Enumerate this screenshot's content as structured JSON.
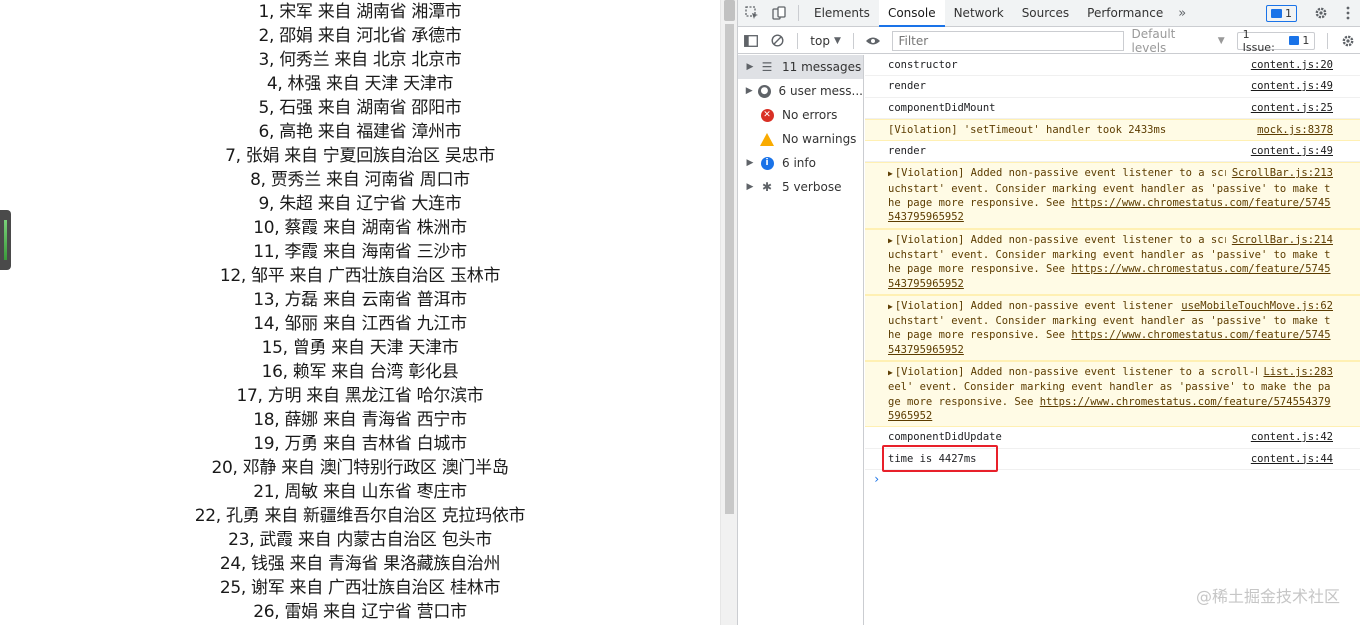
{
  "page": {
    "items": [
      "1, 宋军 来自 湖南省 湘潭市",
      "2, 邵娟 来自 河北省 承德市",
      "3, 何秀兰 来自 北京 北京市",
      "4, 林强 来自 天津 天津市",
      "5, 石强 来自 湖南省 邵阳市",
      "6, 高艳 来自 福建省 漳州市",
      "7, 张娟 来自 宁夏回族自治区 吴忠市",
      "8, 贾秀兰 来自 河南省 周口市",
      "9, 朱超 来自 辽宁省 大连市",
      "10, 蔡霞 来自 湖南省 株洲市",
      "11, 李霞 来自 海南省 三沙市",
      "12, 邹平 来自 广西壮族自治区 玉林市",
      "13, 方磊 来自 云南省 普洱市",
      "14, 邹丽 来自 江西省 九江市",
      "15, 曾勇 来自 天津 天津市",
      "16, 赖军 来自 台湾 彰化县",
      "17, 方明 来自 黑龙江省 哈尔滨市",
      "18, 薛娜 来自 青海省 西宁市",
      "19, 万勇 来自 吉林省 白城市",
      "20, 邓静 来自 澳门特别行政区 澳门半岛",
      "21, 周敏 来自 山东省 枣庄市",
      "22, 孔勇 来自 新疆维吾尔自治区 克拉玛依市",
      "23, 武霞 来自 内蒙古自治区 包头市",
      "24, 钱强 来自 青海省 果洛藏族自治州",
      "25, 谢军 来自 广西壮族自治区 桂林市",
      "26, 雷娟 来自 辽宁省 营口市"
    ]
  },
  "devtools": {
    "tabs": [
      "Elements",
      "Console",
      "Network",
      "Sources",
      "Performance"
    ],
    "more_tabs": "»",
    "messages_badge": "1",
    "toolbar": {
      "context": "top",
      "filter_placeholder": "Filter",
      "levels": "Default levels",
      "issues_label": "1 Issue:",
      "issues_count": "1"
    },
    "sidebar": [
      {
        "label": "11 messages",
        "icon": "list-icon"
      },
      {
        "label": "6 user mess...",
        "icon": "user-icon"
      },
      {
        "label": "No errors",
        "icon": "error-icon"
      },
      {
        "label": "No warnings",
        "icon": "warning-icon"
      },
      {
        "label": "6 info",
        "icon": "info-icon"
      },
      {
        "label": "5 verbose",
        "icon": "bug-icon"
      }
    ],
    "console": [
      {
        "type": "log",
        "text": "constructor",
        "source": "content.js:20"
      },
      {
        "type": "log",
        "text": "render",
        "source": "content.js:49"
      },
      {
        "type": "log",
        "text": "componentDidMount",
        "source": "content.js:25"
      },
      {
        "type": "warn",
        "text": "[Violation] 'setTimeout' handler took 2433ms",
        "source": "mock.js:8378"
      },
      {
        "type": "log",
        "text": "render",
        "source": "content.js:49"
      },
      {
        "type": "warn",
        "text": "[Violation] Added non-passive event listener to a scroll-blocking 'touchstart' event. Consider marking event handler as 'passive' to make the page more responsive. See ",
        "link": "https://www.chromestatus.com/feature/5745543795965952",
        "source": "ScrollBar.js:213"
      },
      {
        "type": "warn",
        "text": "[Violation] Added non-passive event listener to a scroll-blocking 'touchstart' event. Consider marking event handler as 'passive' to make the page more responsive. See ",
        "link": "https://www.chromestatus.com/feature/5745543795965952",
        "source": "ScrollBar.js:214"
      },
      {
        "type": "warn",
        "text": "[Violation] Added non-passive event listener to a scroll-blocking 'touchstart' event. Consider marking event handler as 'passive' to make the page more responsive. See ",
        "link": "https://www.chromestatus.com/feature/5745543795965952",
        "source": "useMobileTouchMove.js:62"
      },
      {
        "type": "warn",
        "text": "[Violation] Added non-passive event listener to a scroll-blocking 'wheel' event. Consider marking event handler as 'passive' to make the page more responsive. See ",
        "link": "https://www.chromestatus.com/feature/5745543795965952",
        "source": "List.js:283"
      },
      {
        "type": "log",
        "text": "componentDidUpdate",
        "source": "content.js:42"
      },
      {
        "type": "log",
        "text": "time is 4427ms",
        "source": "content.js:44"
      }
    ],
    "prompt": "›"
  },
  "watermark": "@稀土掘金技术社区"
}
